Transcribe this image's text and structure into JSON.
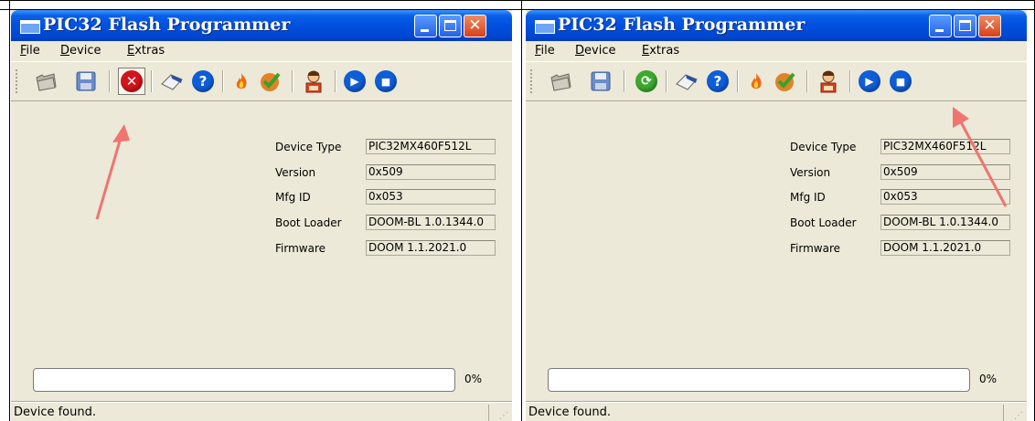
{
  "window": {
    "title": "PIC32 Flash Programmer",
    "min_glyph": "_",
    "max_glyph": "□",
    "close_glyph": "✕"
  },
  "menu": [
    "File",
    "Device",
    "Extras"
  ],
  "toolbar_icons": [
    "open-folder-icon",
    "save-disk-icon",
    "disconnect-icon",
    "eraser-icon",
    "help-icon",
    "burn-flame-icon",
    "verify-check-icon",
    "reader-person-icon",
    "run-icon",
    "stop-icon"
  ],
  "connect_icon": "connect-refresh-icon",
  "colors": {
    "titlebar": "#0050e0",
    "close": "#d8401a",
    "stop_red": "#d4141a",
    "blue_btn": "#0f5ed9",
    "connect_green": "#3caa2f",
    "arrow": "#f07470",
    "face": "#ece9d8"
  },
  "device": {
    "labels": {
      "type": "Device Type",
      "version": "Version",
      "mfg": "Mfg ID",
      "boot": "Boot Loader",
      "firmware": "Firmware"
    },
    "values": {
      "type": "PIC32MX460F512L",
      "version": "0x509",
      "mfg": "0x053",
      "boot": "DOOM-BL 1.0.1344.0",
      "firmware": "DOOM 1.1.2021.0"
    }
  },
  "progress": {
    "value": 0,
    "label": "0%"
  },
  "status": {
    "text": "Device found."
  }
}
